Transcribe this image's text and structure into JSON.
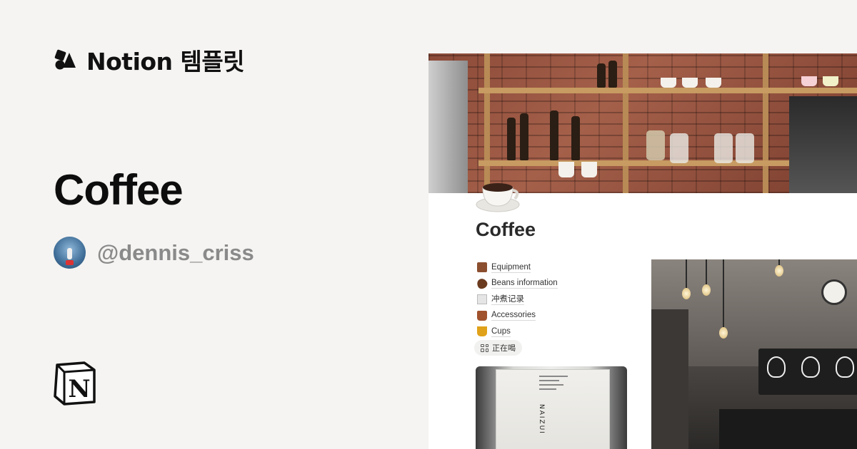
{
  "brand": {
    "text": "Notion 템플릿",
    "logo_icon": "notion-shapes-icon"
  },
  "page": {
    "title": "Coffee"
  },
  "author": {
    "handle": "@dennis_criss",
    "avatar_icon": "avatar-icon"
  },
  "footer_logo": {
    "icon": "notion-n-logo"
  },
  "preview": {
    "title": "Coffee",
    "page_icon": "coffee-cup-icon",
    "nav_items": [
      {
        "label": "Equipment",
        "icon": "coffee-machine-icon"
      },
      {
        "label": "Beans information",
        "icon": "coffee-beans-icon"
      },
      {
        "label": "冲煮记录",
        "icon": "notepad-icon"
      },
      {
        "label": "Accessories",
        "icon": "grinder-icon"
      },
      {
        "label": "Cups",
        "icon": "cup-icon"
      }
    ],
    "chip": {
      "label": "正在喝",
      "icon": "gallery-grid-icon"
    },
    "card": {
      "bag_brand": "NAIZUI"
    }
  }
}
